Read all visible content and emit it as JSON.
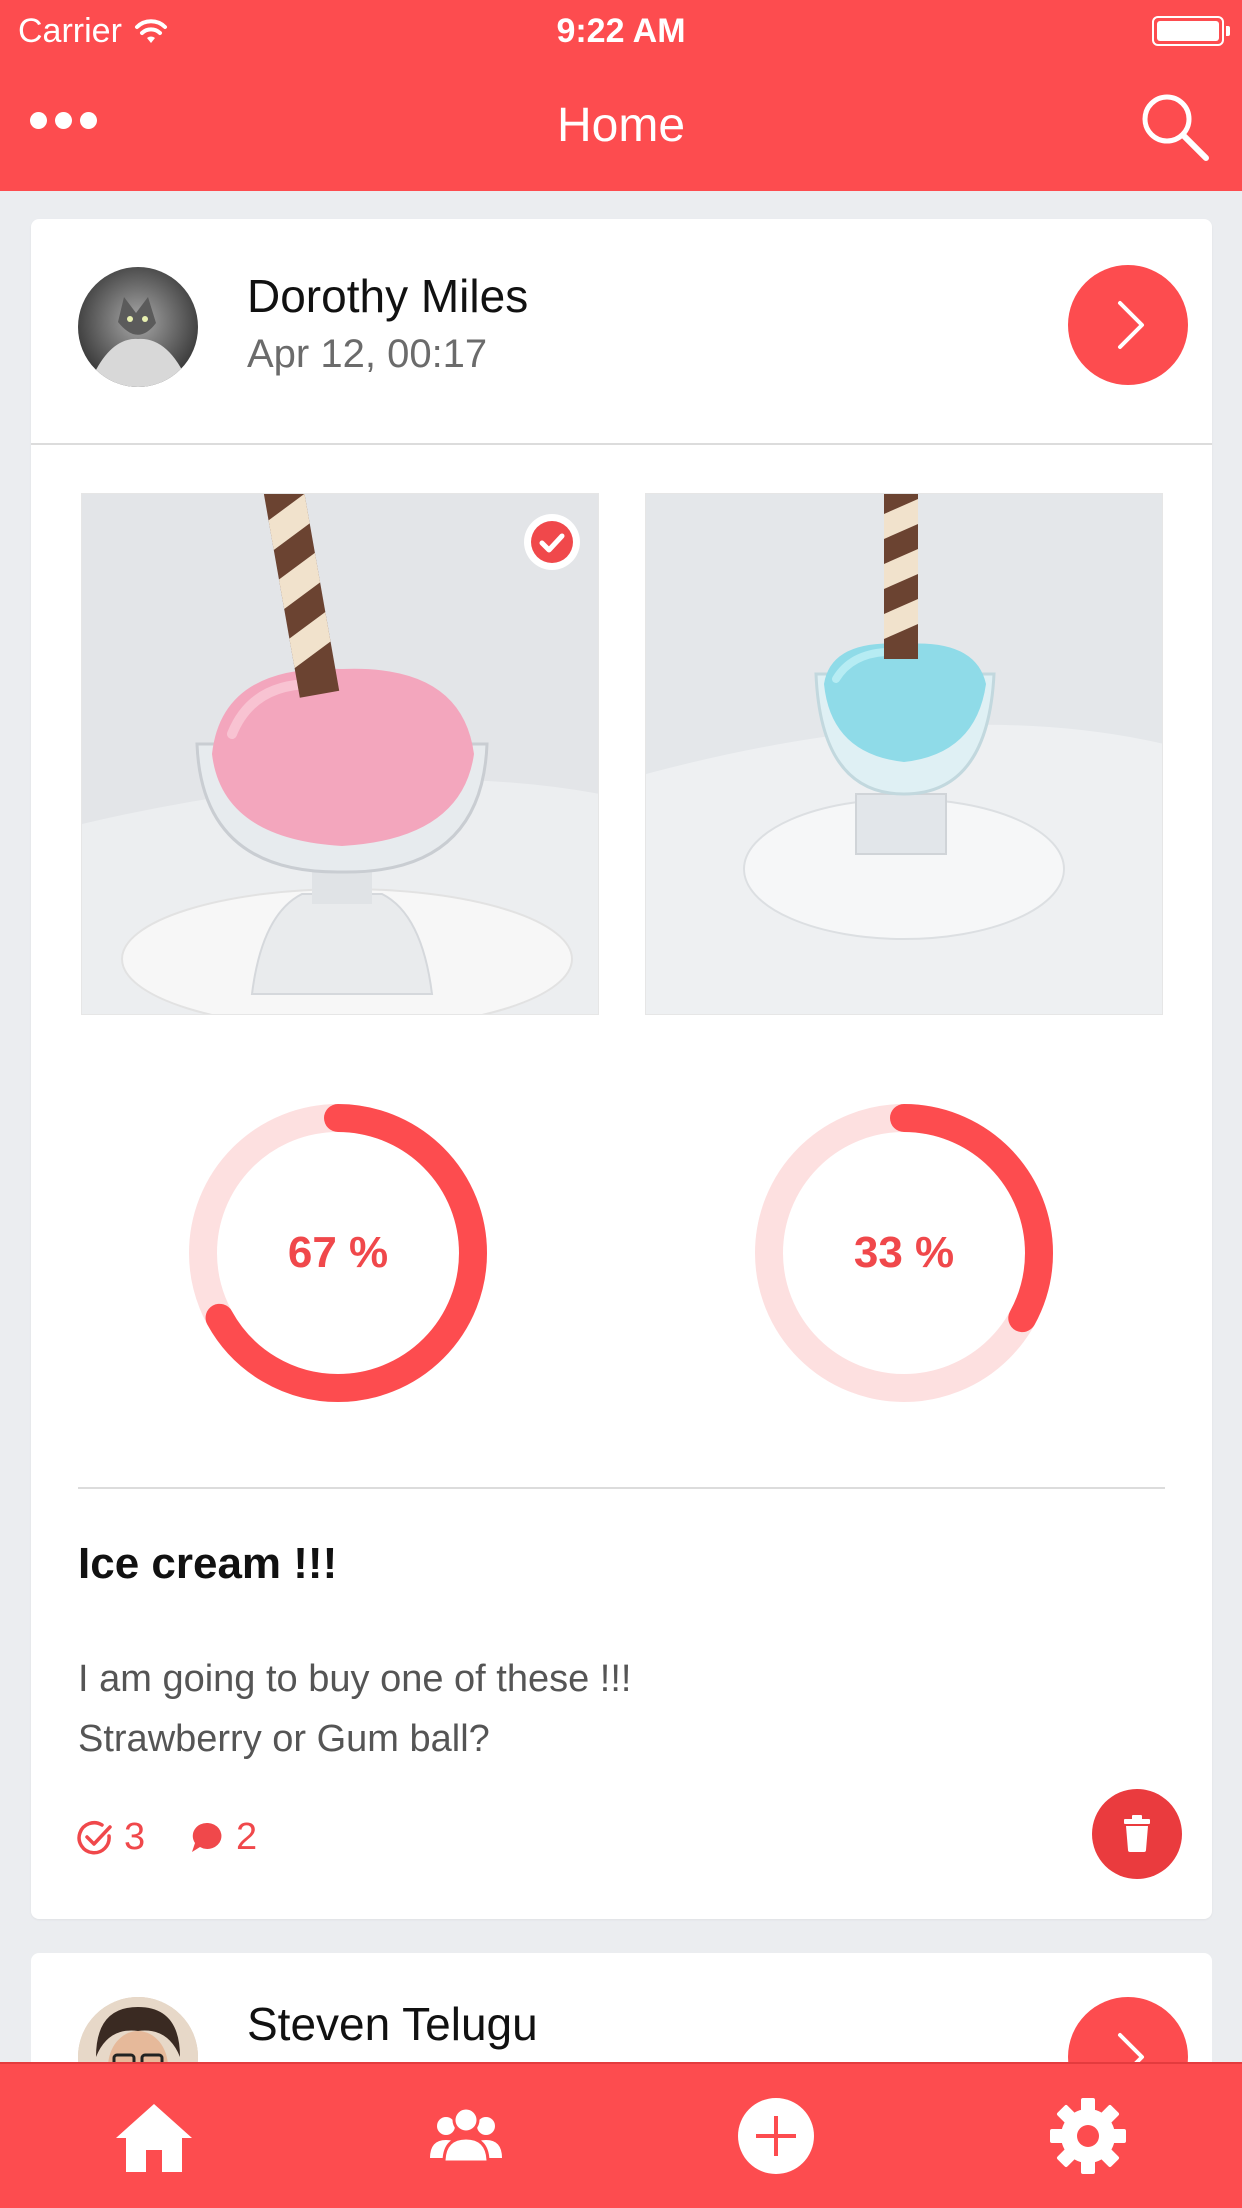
{
  "status_bar": {
    "carrier": "Carrier",
    "time": "9:22 AM"
  },
  "nav": {
    "title": "Home"
  },
  "colors": {
    "accent": "#fd4c4f",
    "ring_track": "#fde0e0",
    "background": "#ebedf0"
  },
  "post": {
    "author": "Dorothy Miles",
    "date": "Apr 12, 00:17",
    "options": [
      {
        "image": "strawberry-ice-cream-photo",
        "selected": true,
        "percent": 67,
        "percent_label": "67 %"
      },
      {
        "image": "gum-ball-ice-cream-photo",
        "selected": false,
        "percent": 33,
        "percent_label": "33 %"
      }
    ],
    "title": "Ice cream !!!",
    "body_line1": "I am going to buy one of these !!!",
    "body_line2": "Strawberry or Gum ball?",
    "votes": "3",
    "comments": "2"
  },
  "next_post": {
    "author": "Steven Telugu"
  },
  "tabbar": {
    "items": [
      "home-icon",
      "groups-icon",
      "add-icon",
      "settings-icon"
    ]
  }
}
